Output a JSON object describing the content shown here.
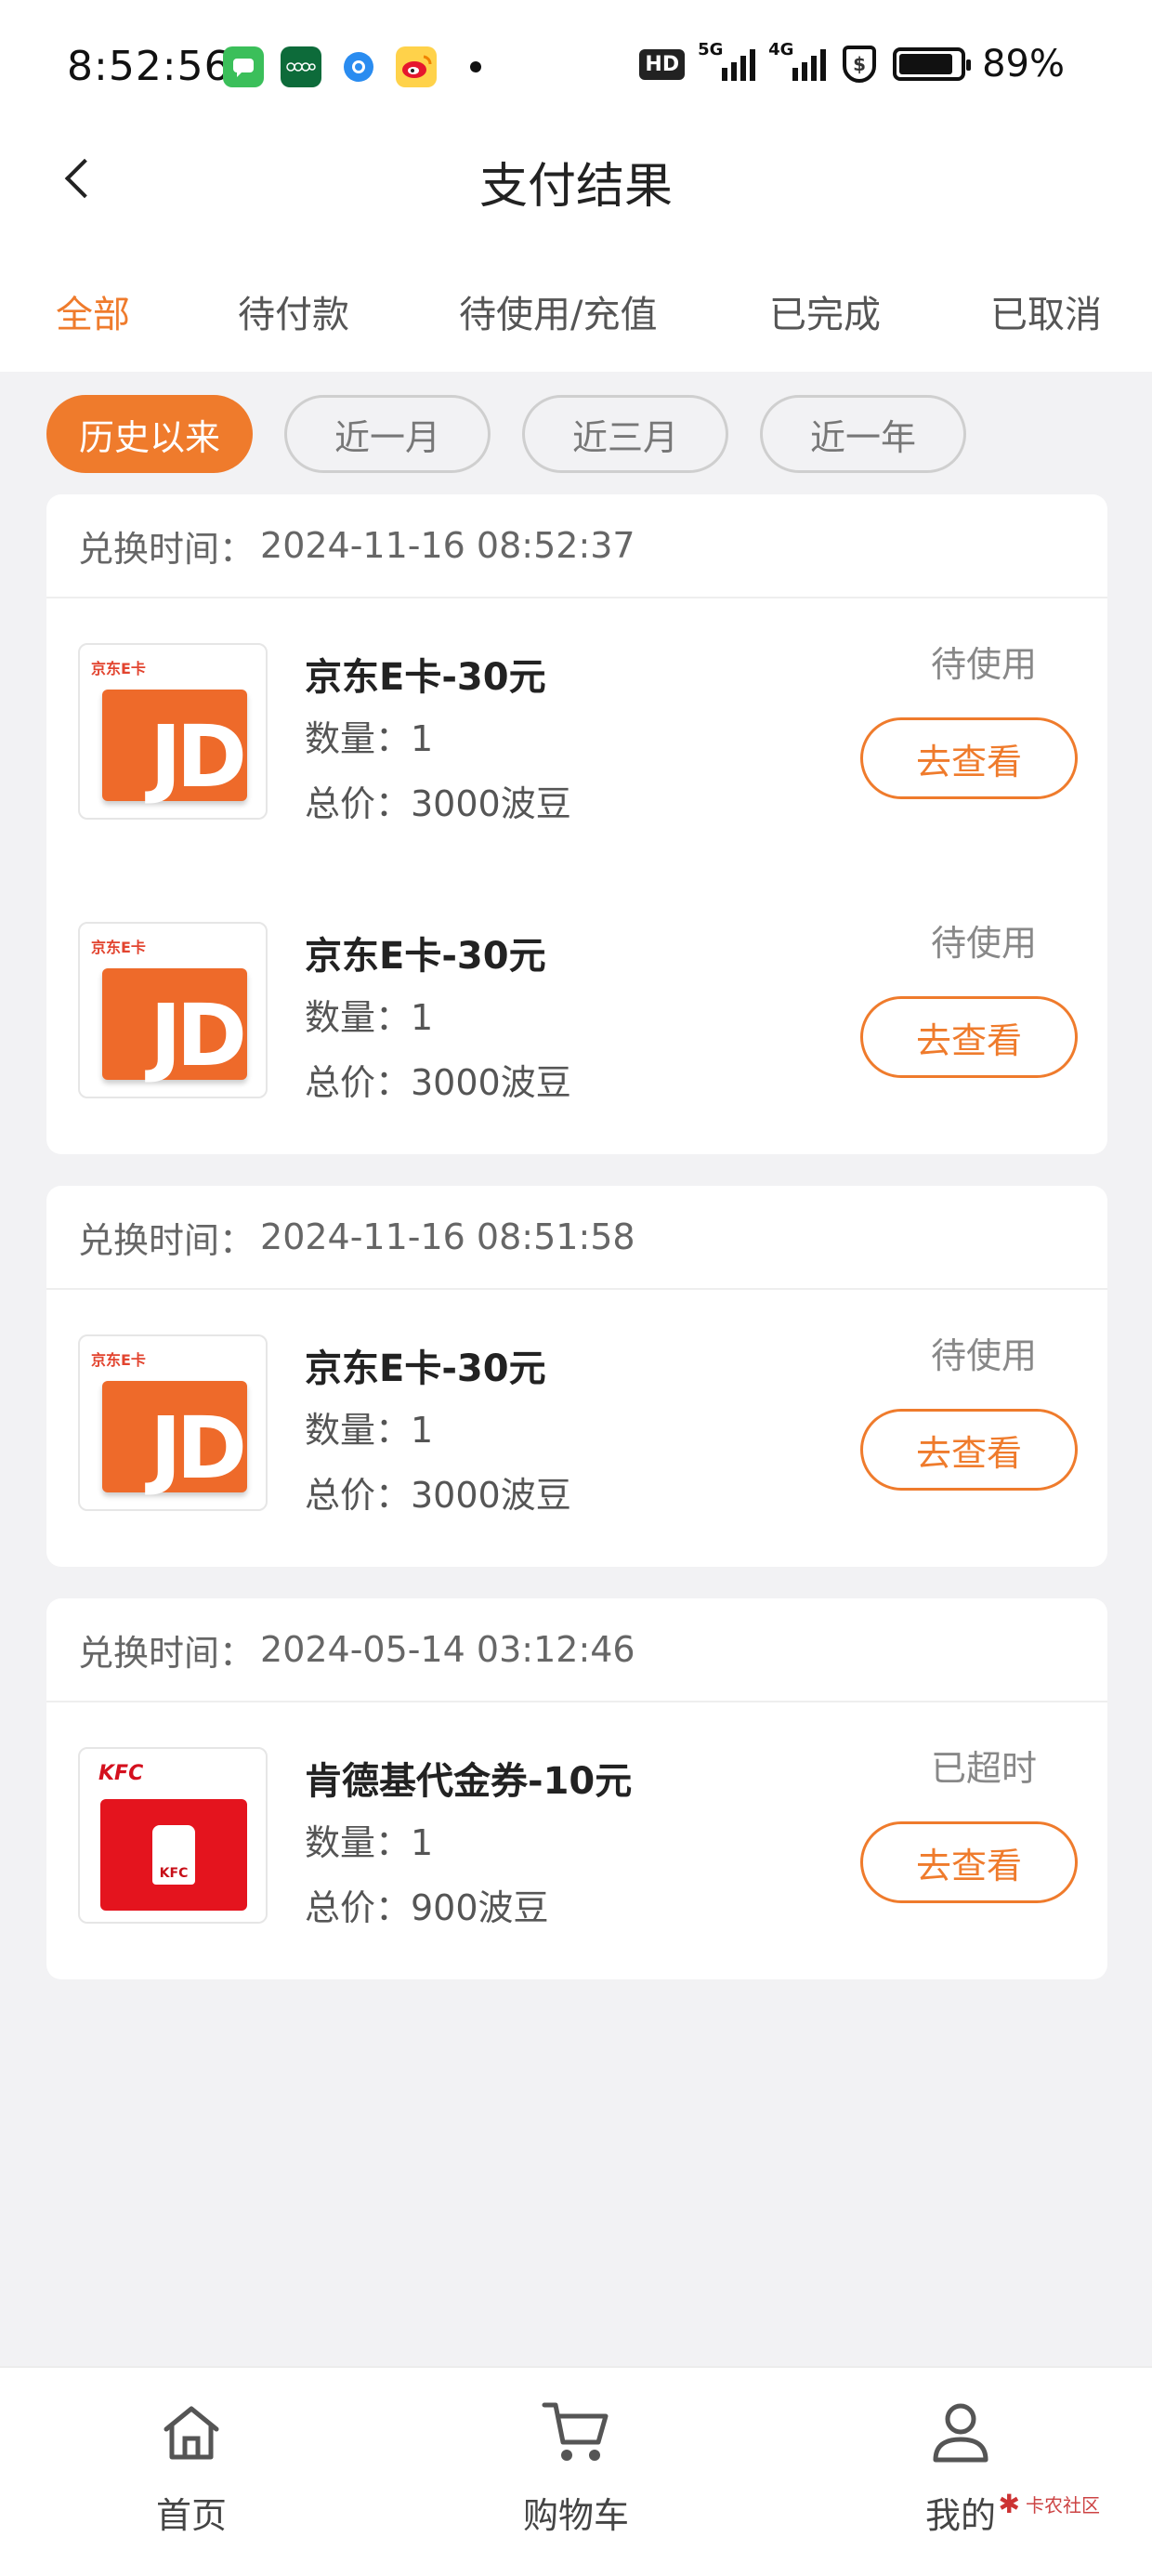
{
  "status_bar": {
    "time": "8:52:56",
    "icons": [
      "messages-icon",
      "oppo-icon",
      "browser-icon",
      "weibo-icon"
    ],
    "hd_label": "HD",
    "net1": "5G",
    "net2": "4G",
    "shield_label": "$",
    "battery_pct": "89%",
    "battery_level": 0.89
  },
  "nav": {
    "title": "支付结果"
  },
  "tabs": [
    {
      "label": "全部",
      "active": true
    },
    {
      "label": "待付款",
      "active": false
    },
    {
      "label": "待使用/充值",
      "active": false
    },
    {
      "label": "已完成",
      "active": false
    },
    {
      "label": "已取消",
      "active": false
    }
  ],
  "filters": [
    {
      "label": "历史以来",
      "active": true
    },
    {
      "label": "近一月",
      "active": false
    },
    {
      "label": "近三月",
      "active": false
    },
    {
      "label": "近一年",
      "active": false
    }
  ],
  "orders": [
    {
      "time_label": "兑换时间：",
      "time": "2024-11-16 08:52:37",
      "items": [
        {
          "thumb_tag": "京东E卡",
          "thumb_text": "JD",
          "name": "京东E卡-30元",
          "qty": "数量：1",
          "price": "总价：3000波豆",
          "status": "待使用",
          "action": "去查看"
        },
        {
          "thumb_tag": "京东E卡",
          "thumb_text": "JD",
          "name": "京东E卡-30元",
          "qty": "数量：1",
          "price": "总价：3000波豆",
          "status": "待使用",
          "action": "去查看"
        }
      ]
    },
    {
      "time_label": "兑换时间：",
      "time": "2024-11-16 08:51:58",
      "items": [
        {
          "thumb_tag": "京东E卡",
          "thumb_text": "JD",
          "name": "京东E卡-30元",
          "qty": "数量：1",
          "price": "总价：3000波豆",
          "status": "待使用",
          "action": "去查看"
        }
      ]
    },
    {
      "time_label": "兑换时间：",
      "time": "2024-05-14 03:12:46",
      "items": [
        {
          "thumb_tag": "KFC",
          "thumb_text": "KFC",
          "name": "肯德基代金券-10元",
          "qty": "数量：1",
          "price": "总价：900波豆",
          "status": "已超时",
          "action": "去查看"
        }
      ]
    }
  ],
  "bottom_nav": [
    {
      "label": "首页",
      "icon": "home-icon"
    },
    {
      "label": "购物车",
      "icon": "cart-icon"
    },
    {
      "label": "我的",
      "icon": "profile-icon"
    }
  ],
  "watermark": "卡农社区",
  "colors": {
    "accent": "#ef7b2c",
    "background": "#f2f2f4",
    "jd_orange": "#ee6a2a",
    "kfc_red": "#e4141e"
  }
}
